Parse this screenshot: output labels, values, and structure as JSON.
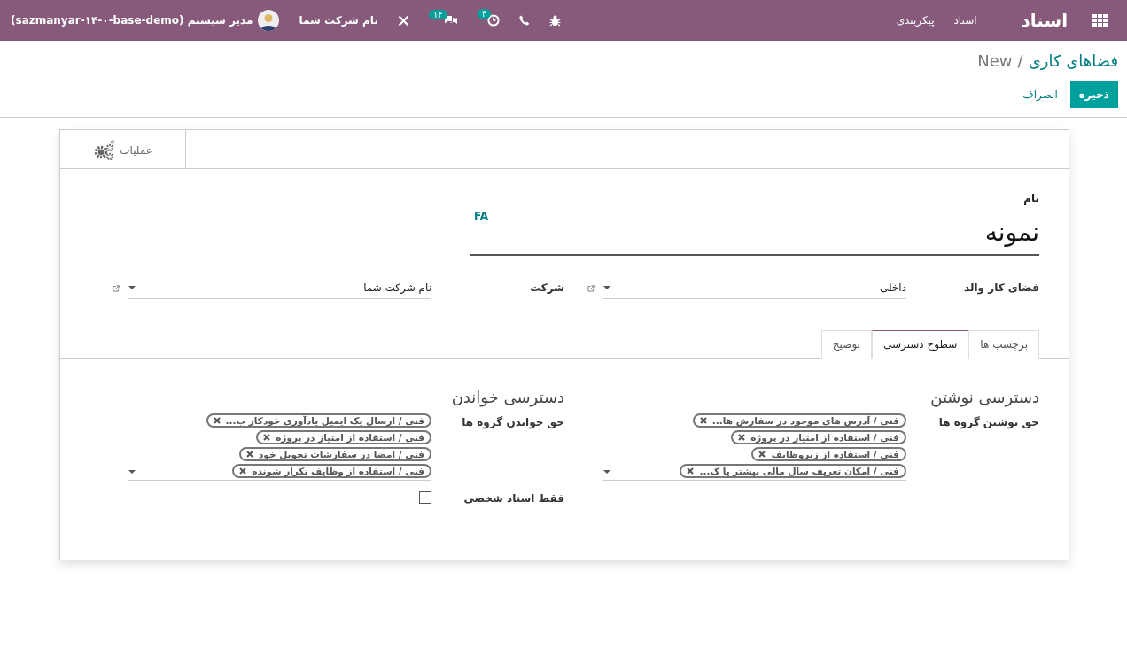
{
  "navbar": {
    "brand": "اسناد",
    "menu": [
      {
        "label": "اسناد"
      },
      {
        "label": "پیکربندی"
      }
    ],
    "activity_badge": "۴",
    "chat_badge": "۱۴",
    "company": "نام شرکت شما",
    "user": "مدیر سیستم (sazmanyar-۱۴-۰-base-demo)"
  },
  "breadcrumb": {
    "parent": "فضاهای کاری",
    "separator": "/",
    "current": "New"
  },
  "buttons": {
    "save": "ذخیره",
    "discard": "انصراف"
  },
  "action_button": "عملیات",
  "name": {
    "label": "نام",
    "value": "نمونه",
    "lang": "FA"
  },
  "fields": [
    {
      "label": "فضای کار والد",
      "value": "داخلی"
    },
    {
      "label": "شرکت",
      "value": "نام شرکت شما"
    }
  ],
  "tabs": [
    {
      "label": "برچسب ها",
      "selected": false
    },
    {
      "label": "سطوح دسترسی",
      "selected": true
    },
    {
      "label": "توضیح",
      "selected": false
    }
  ],
  "groups": [
    {
      "title": "دسترسی نوشتن",
      "label": "حق نوشتن گروه ها",
      "tags": [
        "فنی / آدرس های موجود در سفارش ها...",
        "فنی / استفاده از امتیاز در پروژه",
        "فنی / استفاده از زیروظایف",
        "فنی / امکان تعریف سال مالی بیشتر یا ک..."
      ]
    },
    {
      "title": "دسترسی خواندن",
      "label": "حق خواندن گروه ها",
      "tags": [
        "فنی / ارسال یک ایمیل یادآوری خودکار ب...",
        "فنی / استفاده از امتیاز در پروژه",
        "فنی / امضا در سفارشات تحویل خود",
        "فنی / استفاده از وظایف تکرار شونده"
      ],
      "checkbox": {
        "label": "فقط اسناد شخصی",
        "checked": false
      }
    }
  ]
}
